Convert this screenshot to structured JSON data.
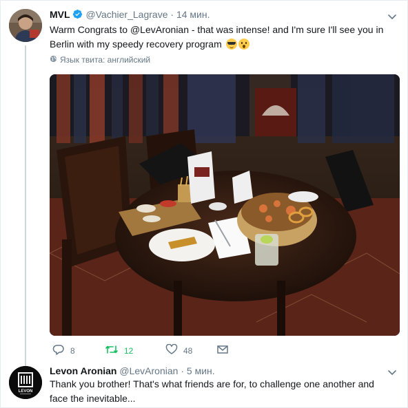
{
  "tweet1": {
    "name": "MVL",
    "handle": "@Vachier_Lagrave",
    "dot": "·",
    "time": "14 мин.",
    "text_line1": "Warm Congrats to @LevAronian - that was intense! and I'm sure I'll see you in",
    "text_line2": "Berlin with my speedy recovery program",
    "emojis": [
      "smiling-face-with-sunglasses",
      "face-with-open-mouth"
    ],
    "translate_label": "Язык твита: английский",
    "photo_alt": "Restaurant table with snacks and drinks",
    "actions": {
      "reply_count": "8",
      "retweet_count": "12",
      "like_count": "48"
    }
  },
  "tweet2": {
    "name": "Levon Aronian",
    "handle": "@LevAronian",
    "dot": "·",
    "time": "5 мин.",
    "text_line1": "Thank you brother! That's what friends are for, to challenge one another and",
    "text_line2": "face the inevitable...",
    "avatar_logo_text": "LEVON"
  },
  "colors": {
    "text": "#14171a",
    "secondary": "#657786",
    "verified": "#1da1f2",
    "retweet_active": "#17bf63",
    "thread_line": "#ccd6dd"
  }
}
